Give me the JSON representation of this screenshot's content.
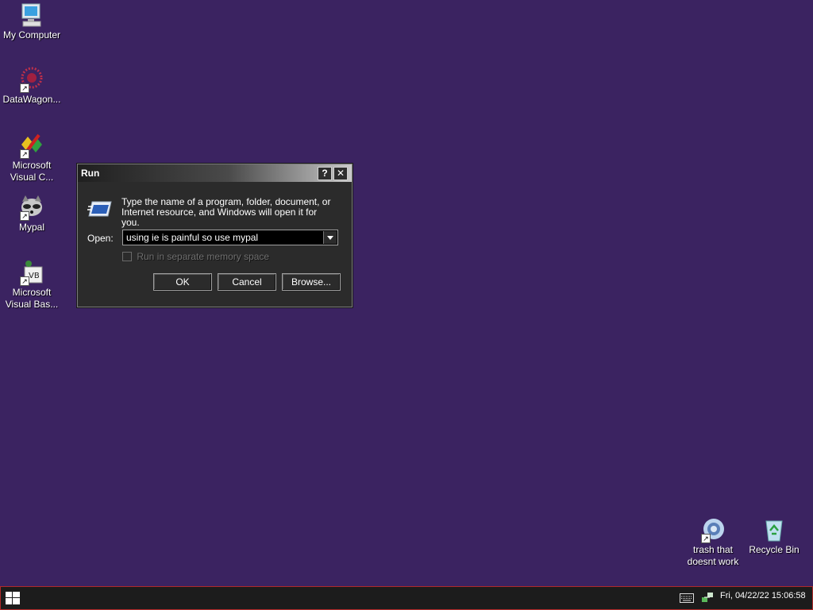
{
  "desktop": {
    "icons": [
      {
        "label": "My Computer"
      },
      {
        "label": "DataWagon..."
      },
      {
        "label": "Microsoft\nVisual C..."
      },
      {
        "label": "Mypal"
      },
      {
        "label": "Microsoft\nVisual Bas..."
      },
      {
        "label": "trash that\ndoesnt work"
      },
      {
        "label": "Recycle Bin"
      }
    ]
  },
  "run_dialog": {
    "title": "Run",
    "help_glyph": "?",
    "close_glyph": "✕",
    "description": "Type the name of a program, folder, document, or Internet resource, and Windows will open it for you.",
    "open_label": "Open:",
    "open_value": "using ie is painful so use mypal",
    "checkbox_label": "Run in separate memory space",
    "checkbox_checked": false,
    "ok_label": "OK",
    "cancel_label": "Cancel",
    "browse_label": "Browse..."
  },
  "taskbar": {
    "clock": "Fri, 04/22/22 15:06:58"
  },
  "colors": {
    "desktop_bg": "#3b2361",
    "dialog_bg": "#2b2b2b",
    "taskbar_bg": "#1c1c1c",
    "taskbar_border": "#b02a2a"
  }
}
